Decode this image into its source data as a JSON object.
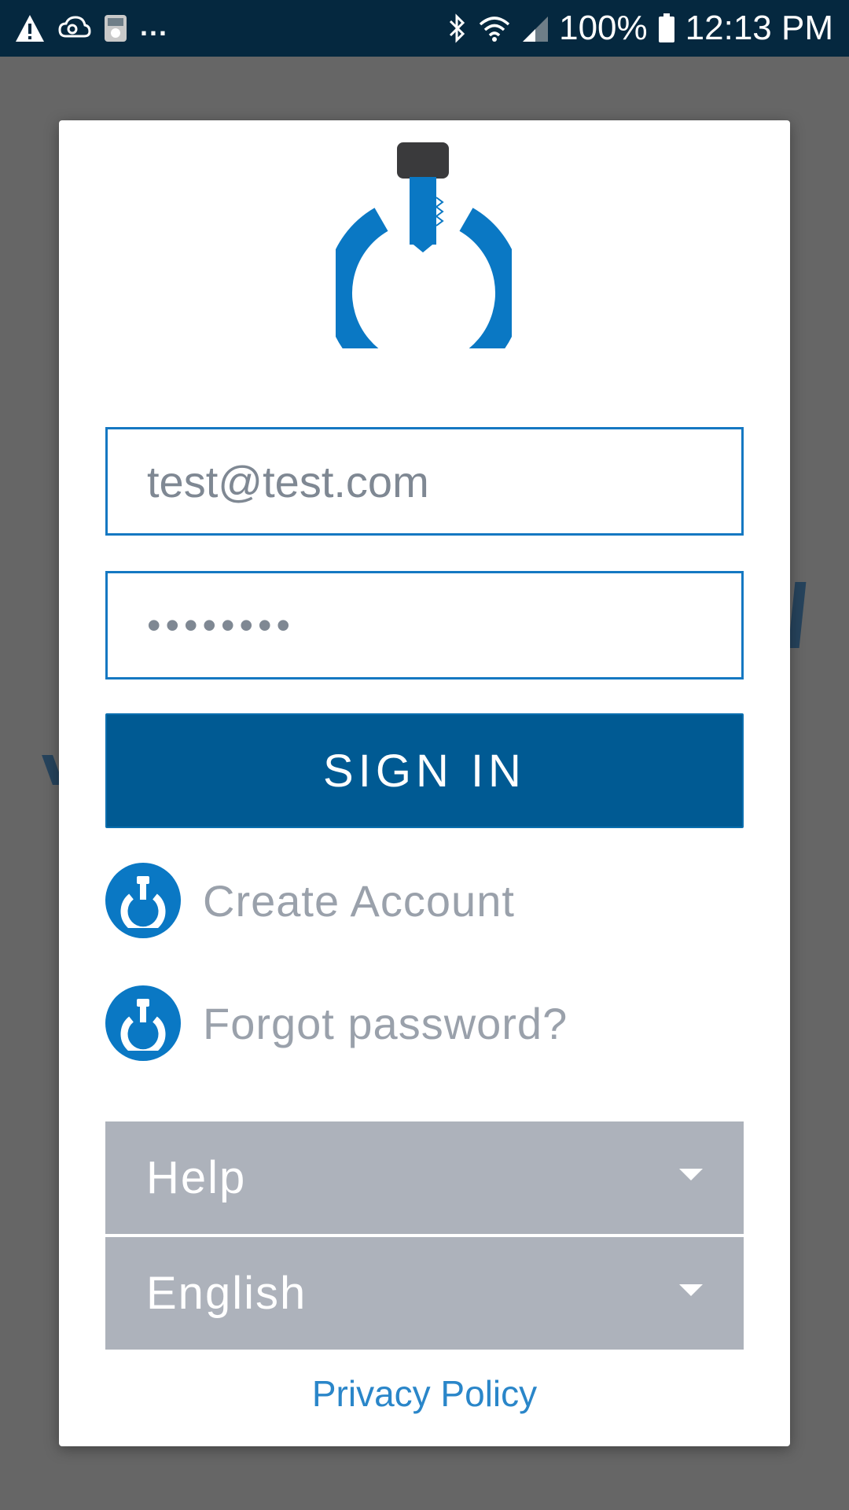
{
  "status_bar": {
    "icons_left": [
      "warning-icon",
      "cloud-sync-icon",
      "app-notification-icon"
    ],
    "more": "...",
    "icons_right": [
      "bluetooth-icon",
      "wifi-icon",
      "signal-icon",
      "battery-icon"
    ],
    "battery": "100%",
    "time": "12:13 PM"
  },
  "login": {
    "logo_icon": "power-key-logo-icon",
    "email_value": "test@test.com",
    "password_value": "••••••••",
    "sign_in_label": "SIGN IN",
    "create_account_label": "Create Account",
    "forgot_password_label": "Forgot password?",
    "help_label": "Help",
    "language_label": "English",
    "privacy_label": "Privacy Policy"
  },
  "colors": {
    "brand_blue": "#0a78c4",
    "button_blue": "#005a93",
    "status_bar": "#05283f",
    "dropdown_gray": "#adb2bb"
  }
}
